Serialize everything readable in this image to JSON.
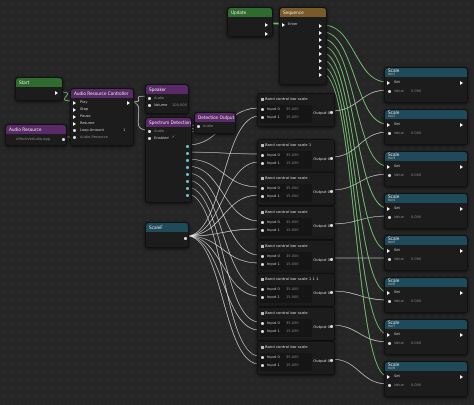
{
  "colors": {
    "exec": "#8fd18f",
    "data": "#dddddd",
    "output": "#6cc3c8",
    "wire": "#7fd47f"
  },
  "nodes": {
    "update": {
      "title": "Update"
    },
    "sequence": {
      "title": "Sequence",
      "enter": "Enter"
    },
    "start": {
      "title": "Start"
    },
    "audio_resource": {
      "title": "Audio Resource",
      "value": "AffectiveAudio.ogg"
    },
    "arc": {
      "title": "Audio Resource Controller",
      "rows": [
        "Play",
        "Stop",
        "Pause",
        "Resume",
        "Loop Amount",
        "Audio Resource"
      ],
      "loop_value": "1"
    },
    "speaker": {
      "title": "Speaker",
      "audio": "Audio",
      "volume_label": "Volume",
      "volume_value": "100.000"
    },
    "spectrum": {
      "title": "Spectrum Detection",
      "audio": "Audio",
      "enabled": "Enabled"
    },
    "detection": {
      "title": "Detection Output",
      "audio": "Audio"
    },
    "scalef": {
      "title": "ScaleF"
    }
  },
  "bands": [
    {
      "title": "Band control bar scale",
      "input0": "Input 0",
      "input1": "Input 1",
      "v0": "35.000",
      "v1": "15.000",
      "output": "Output 0"
    },
    {
      "title": "Band control bar scale 1",
      "input0": "Input 0",
      "input1": "Input 1",
      "v0": "35.000",
      "v1": "15.000",
      "output": "Output 0"
    },
    {
      "title": "Band control bar scale",
      "input0": "Input 0",
      "input1": "Input 1",
      "v0": "35.000",
      "v1": "15.000",
      "output": "Output 0"
    },
    {
      "title": "Band control bar scale",
      "input0": "Input 0",
      "input1": "Input 1",
      "v0": "35.000",
      "v1": "15.000",
      "output": "Output 0"
    },
    {
      "title": "Band control bar scale",
      "input0": "Input 0",
      "input1": "Input 1",
      "v0": "35.000",
      "v1": "15.000",
      "output": "Output 0"
    },
    {
      "title": "Band control bar scale 1 1 1",
      "input0": "Input 0",
      "input1": "Input 1",
      "v0": "35.000",
      "v1": "15.000",
      "output": "Output 0"
    },
    {
      "title": "Band control bar scale",
      "input0": "Input 0",
      "input1": "Input 1",
      "v0": "35.000",
      "v1": "15.000",
      "output": "Output 0"
    },
    {
      "title": "Band control bar scale",
      "input0": "Input 0",
      "input1": "Input 1",
      "v0": "35.000",
      "v1": "15.000",
      "output": "Output 0"
    }
  ],
  "scales": [
    {
      "title": "Scale",
      "sub": "bar1",
      "set": "Set",
      "value": "Value",
      "val": "0.000"
    },
    {
      "title": "Scale",
      "sub": "bar2",
      "set": "Set",
      "value": "Value",
      "val": "0.000"
    },
    {
      "title": "Scale",
      "sub": "bar3",
      "set": "Set",
      "value": "Value",
      "val": "0.000"
    },
    {
      "title": "Scale",
      "sub": "bar4",
      "set": "Set",
      "value": "Value",
      "val": "0.000"
    },
    {
      "title": "Scale",
      "sub": "bar5",
      "set": "Set",
      "value": "Value",
      "val": "0.000"
    },
    {
      "title": "Scale",
      "sub": "bar6",
      "set": "Set",
      "value": "Value",
      "val": "0.000"
    },
    {
      "title": "Scale",
      "sub": "bar7",
      "set": "Set",
      "value": "Value",
      "val": "0.000"
    },
    {
      "title": "Scale",
      "sub": "bar8",
      "set": "Set",
      "value": "Value",
      "val": "0.000"
    }
  ]
}
